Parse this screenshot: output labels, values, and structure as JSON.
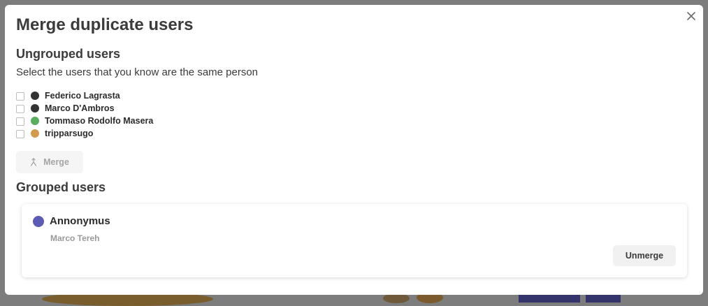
{
  "modal": {
    "title": "Merge duplicate users",
    "close_icon": "close-icon"
  },
  "ungrouped": {
    "title": "Ungrouped users",
    "subtitle": "Select the users that you know are the same person",
    "users": [
      {
        "name": "Federico Lagrasta",
        "color": "#333333",
        "checked": false
      },
      {
        "name": "Marco D'Ambros",
        "color": "#333333",
        "checked": false
      },
      {
        "name": "Tommaso Rodolfo Masera",
        "color": "#5aac5f",
        "checked": false
      },
      {
        "name": "tripparsugo",
        "color": "#d29a4e",
        "checked": false
      }
    ],
    "merge_label": "Merge",
    "merge_icon": "merge-icon"
  },
  "grouped": {
    "title": "Grouped users",
    "groups": [
      {
        "name": "Annonymus",
        "color": "#5c5cb5",
        "members": [
          "Marco Tereh"
        ],
        "unmerge_label": "Unmerge"
      }
    ]
  }
}
